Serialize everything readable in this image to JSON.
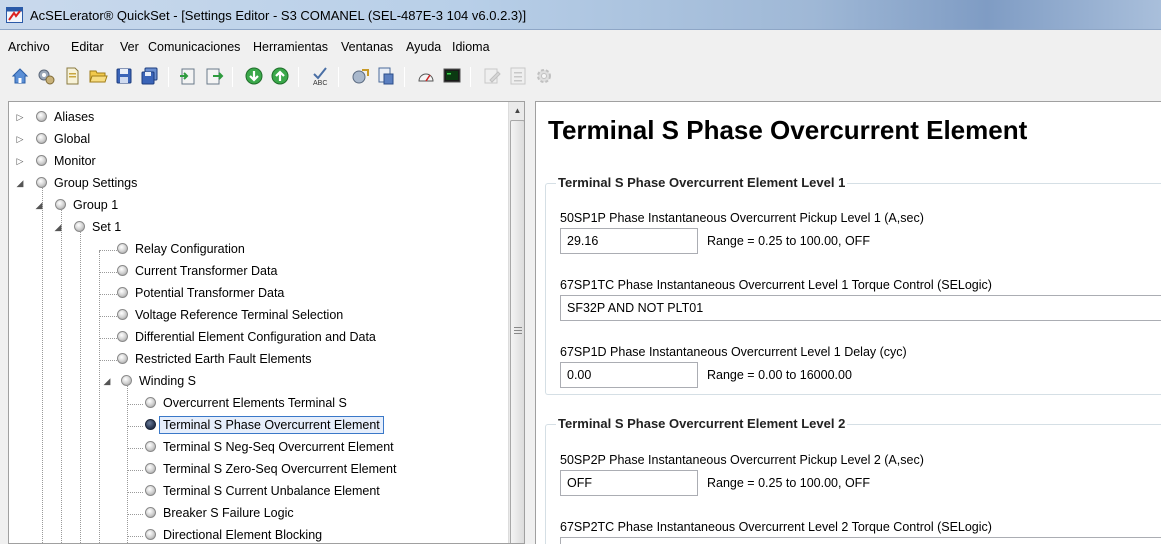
{
  "window": {
    "title": "AcSELerator® QuickSet - [Settings Editor - S3 COMANEL (SEL-487E-3 104 v6.0.2.3)]"
  },
  "menu": [
    "Archivo",
    "Editar",
    "Ver",
    "Comunicaciones",
    "Herramientas",
    "Ventanas",
    "Ayuda",
    "Idioma"
  ],
  "toolbar": {
    "buttons": [
      "home-icon",
      "settings-gear-icon",
      "new-document-icon",
      "open-folder-icon",
      "save-icon",
      "save-all-icon",
      "import-icon",
      "export-icon",
      "download-icon",
      "upload-icon",
      "abc-check-icon",
      "compare-icon",
      "report-icon",
      "meter-icon",
      "terminal-icon",
      "edit-disabled-icon",
      "list-disabled-icon",
      "gear-disabled-icon"
    ]
  },
  "tree": {
    "items": [
      {
        "label": "Aliases",
        "expander": "▷"
      },
      {
        "label": "Global",
        "expander": "▷"
      },
      {
        "label": "Monitor",
        "expander": "▷"
      },
      {
        "label": "Group Settings",
        "expander": "◢"
      },
      {
        "label": "Group 1",
        "expander": "◢"
      },
      {
        "label": "Set 1",
        "expander": "◢"
      },
      {
        "label": "Relay Configuration",
        "expander": ""
      },
      {
        "label": "Current Transformer Data",
        "expander": ""
      },
      {
        "label": "Potential Transformer Data",
        "expander": ""
      },
      {
        "label": "Voltage Reference Terminal Selection",
        "expander": ""
      },
      {
        "label": "Differential Element Configuration and Data",
        "expander": ""
      },
      {
        "label": "Restricted Earth Fault Elements",
        "expander": ""
      },
      {
        "label": "Winding S",
        "expander": "◢"
      },
      {
        "label": "Overcurrent Elements Terminal S",
        "expander": ""
      },
      {
        "label": "Terminal S Phase Overcurrent Element",
        "expander": "",
        "selected": true
      },
      {
        "label": "Terminal S Neg-Seq Overcurrent Element",
        "expander": ""
      },
      {
        "label": "Terminal S Zero-Seq Overcurrent Element",
        "expander": ""
      },
      {
        "label": "Terminal S Current Unbalance Element",
        "expander": ""
      },
      {
        "label": "Breaker S Failure Logic",
        "expander": ""
      },
      {
        "label": "Directional Element Blocking",
        "expander": ""
      }
    ]
  },
  "settings": {
    "page_title": "Terminal S Phase Overcurrent Element",
    "level1": {
      "title": "Terminal S Phase Overcurrent Element Level 1",
      "pickup": {
        "label": "50SP1P  Phase Instantaneous Overcurrent Pickup Level 1 (A,sec)",
        "value": "29.16",
        "range": "Range = 0.25 to 100.00, OFF"
      },
      "torque": {
        "label": "67SP1TC  Phase Instantaneous Overcurrent Level 1 Torque Control (SELogic)",
        "value": "SF32P AND NOT PLT01"
      },
      "delay": {
        "label": "67SP1D  Phase Instantaneous Overcurrent Level 1 Delay (cyc)",
        "value": "0.00",
        "range": "Range = 0.00 to 16000.00"
      }
    },
    "level2": {
      "title": "Terminal S Phase Overcurrent Element Level 2",
      "pickup": {
        "label": "50SP2P  Phase Instantaneous Overcurrent Pickup Level 2 (A,sec)",
        "value": "OFF",
        "range": "Range = 0.25 to 100.00, OFF"
      },
      "torque": {
        "label": "67SP2TC  Phase Instantaneous Overcurrent Level 2 Torque Control (SELogic)"
      }
    }
  },
  "colors": {
    "selection_border": "#3a78c8",
    "group_border": "#d5dfe5"
  }
}
